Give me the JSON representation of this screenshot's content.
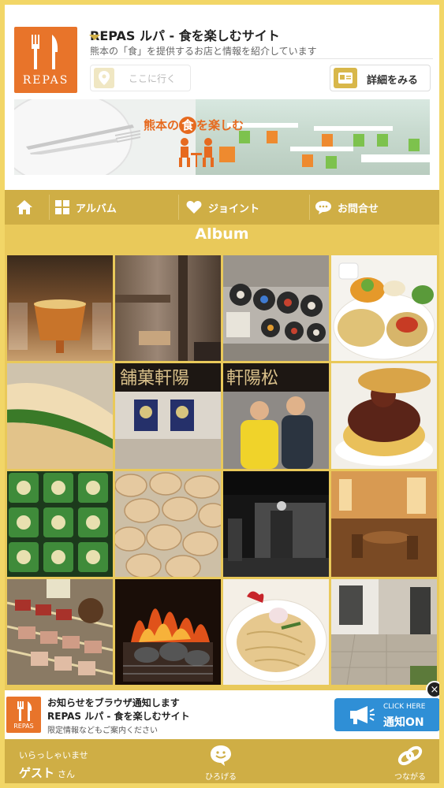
{
  "site": {
    "logo_text": "REPAS",
    "title": "REPAS ルパ - 食を楽しむサイト",
    "subtitle": "熊本の「食」を提供するお店と情報を紹介しています",
    "go_button": "ここに行く",
    "detail_button": "詳細をみる"
  },
  "banner": {
    "tagline_pre": "熊本の",
    "tagline_food": "食",
    "tagline_post": "を楽しむ"
  },
  "nav": {
    "items": [
      {
        "label": "",
        "icon": "home-icon"
      },
      {
        "label": "アルバム",
        "icon": "grid-icon"
      },
      {
        "label": "ジョイント",
        "icon": "heart-icon"
      },
      {
        "label": "お問合せ",
        "icon": "chat-icon"
      }
    ]
  },
  "album": {
    "title": "Album",
    "shop_sign_left": "舗菓軒陽",
    "shop_sign_right": "軒陽松"
  },
  "notification": {
    "logo_text": "REPAS",
    "line1": "お知らせをブラウザ通知します",
    "line2": "REPAS ルパ - 食を楽しむサイト",
    "line3": "限定情報などもご案内ください",
    "button_small": "CLICK HERE",
    "button_main": "通知ON",
    "close": "×"
  },
  "footer": {
    "welcome": "いらっしゃいませ",
    "guest": "ゲスト",
    "honorific": "さん",
    "item1": "ひろげる",
    "item2": "つながる"
  },
  "colors": {
    "accent_gold": "#cfae45",
    "brand_orange": "#e8742a",
    "notify_blue": "#2f8fd6"
  }
}
